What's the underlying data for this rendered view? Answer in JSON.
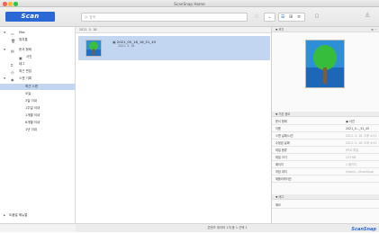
{
  "window": {
    "title": "ScanSnap Home"
  },
  "toolbar": {
    "scan_label": "Scan",
    "search_placeholder": "Q- 검색"
  },
  "sidebar": {
    "items": [
      {
        "label": "Mac",
        "icon": "computer-icon",
        "level": 0,
        "expanded": true
      },
      {
        "label": "휴지통",
        "icon": "trash-icon",
        "level": 1
      },
      {
        "label": "문서 형태",
        "icon": "document-icon",
        "level": 0,
        "expanded": true
      },
      {
        "label": "사진",
        "icon": "photo-icon",
        "level": 1
      },
      {
        "label": "태그",
        "icon": "tag-icon",
        "level": 0
      },
      {
        "label": "최근 편집",
        "icon": "clock-icon",
        "level": 0
      },
      {
        "label": "스캔 기록",
        "icon": "history-icon",
        "level": 0,
        "expanded": true
      },
      {
        "label": "최근 스캔",
        "level": 2,
        "selected": true
      },
      {
        "label": "오늘",
        "level": 2
      },
      {
        "label": "3일 이내",
        "level": 2
      },
      {
        "label": "1주일 이내",
        "level": 2
      },
      {
        "label": "1개월 이내",
        "level": 2
      },
      {
        "label": "6개월 이내",
        "level": 2
      },
      {
        "label": "1년 이내",
        "level": 2
      }
    ],
    "footer": "도움말 메뉴얼"
  },
  "list": {
    "header": "2021. 5. 18.",
    "rows": [
      {
        "name": "2021_05_18_16_51_45",
        "date": "2021. 5. 18."
      }
    ]
  },
  "details": {
    "preview_header": "보기",
    "info_header": "기본 정보",
    "info": [
      {
        "k": "문서 형태",
        "v": "사진"
      },
      {
        "k": "이름",
        "v": "2021_0..._51_45"
      },
      {
        "k": "스캔 날짜/시간",
        "v": "2021. 5. 18. 오후 4:51",
        "dim": true
      },
      {
        "k": "수정된 날짜",
        "v": "2021. 5. 18. 오후 4:51",
        "dim": true
      },
      {
        "k": "파일 종류",
        "v": "JPEG 파일",
        "dim": true
      },
      {
        "k": "파일 크기",
        "v": "223 KB",
        "dim": true
      },
      {
        "k": "페이지",
        "v": "1 페이지",
        "dim": true
      },
      {
        "k": "저장 위치",
        "v": "/Users/.../ScanSnap",
        "dim": true
      },
      {
        "k": "애플리케이션",
        "v": "",
        "dim": true
      }
    ],
    "tags_header": "태그",
    "memo_label": "메모"
  },
  "status": {
    "text": "콘텐츠 데이터 1개 중 1 선택 1",
    "brand": "ScanSnap"
  },
  "colors": {
    "accent": "#2c67d6",
    "selection": "#c2d6f2"
  }
}
